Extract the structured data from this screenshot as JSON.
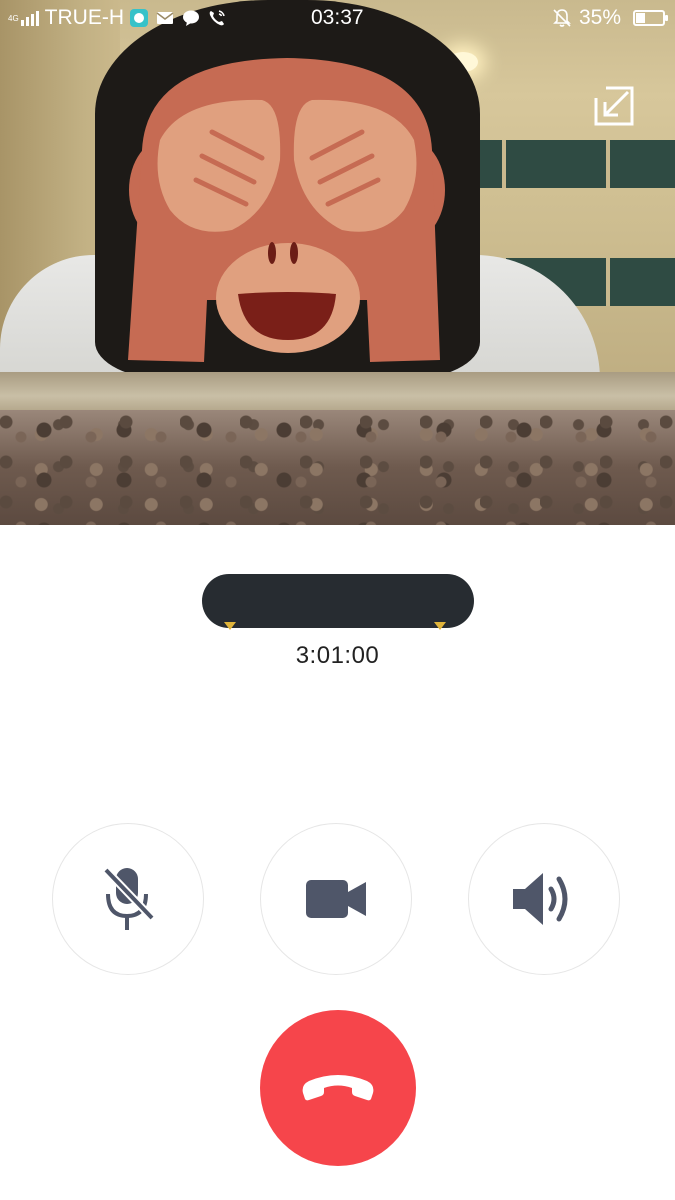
{
  "status_bar": {
    "network": "4G",
    "carrier": "TRUE-H",
    "time": "03:37",
    "battery_percent": "35%",
    "battery_level": 0.35,
    "icons": [
      "signal-icon",
      "messenger-icon",
      "mail-icon",
      "chat-icon",
      "call-icon",
      "bell-off-icon",
      "battery-icon"
    ]
  },
  "video": {
    "overlay_icon": "see-no-evil-monkey-icon",
    "expand_icon": "minimize-window-icon"
  },
  "caller": {
    "call_duration": "3:01:00"
  },
  "controls": {
    "mute_icon": "microphone-off-icon",
    "video_icon": "video-camera-icon",
    "speaker_icon": "speaker-icon",
    "end_call_icon": "hang-up-icon"
  },
  "colors": {
    "end_call": "#f6454b",
    "control_icon": "#4f5669",
    "name_redaction": "#272c31"
  }
}
